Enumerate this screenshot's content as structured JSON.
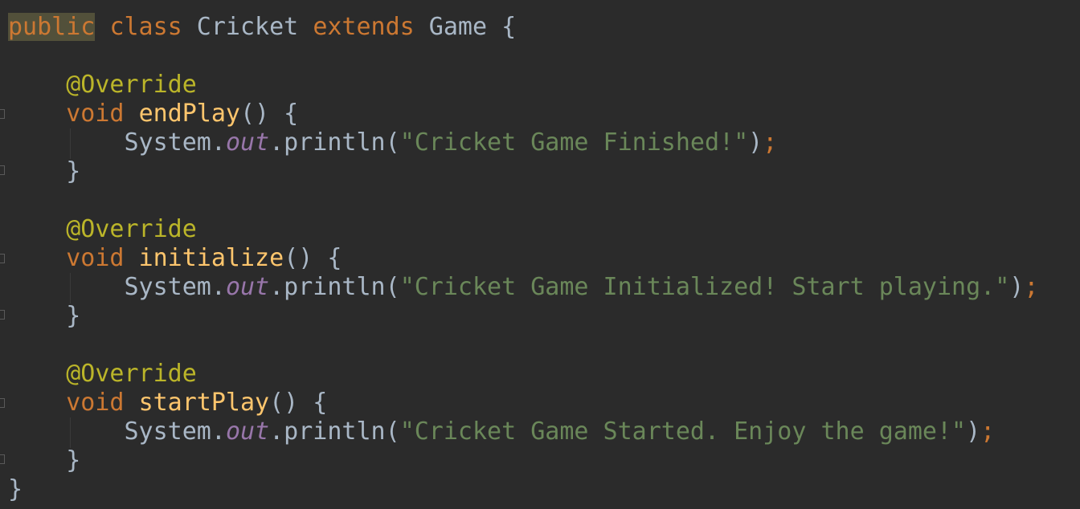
{
  "colors": {
    "background": "#2b2b2b",
    "keyword": "#cc7832",
    "annotation": "#bbb529",
    "method_declaration": "#ffc66d",
    "default_text": "#a9b7c6",
    "static_field": "#9876aa",
    "string": "#6a8759",
    "highlight_background": "#52503a"
  },
  "lines": [
    {
      "tokens": [
        {
          "text": "public",
          "kind": "keyword-hl"
        },
        {
          "text": " ",
          "kind": "plain"
        },
        {
          "text": "class",
          "kind": "keyword"
        },
        {
          "text": " Cricket ",
          "kind": "plain"
        },
        {
          "text": "extends",
          "kind": "keyword"
        },
        {
          "text": " Game {",
          "kind": "plain"
        }
      ]
    },
    {
      "tokens": []
    },
    {
      "tokens": [
        {
          "text": "    ",
          "kind": "plain"
        },
        {
          "text": "@Override",
          "kind": "annotation"
        }
      ]
    },
    {
      "tokens": [
        {
          "text": "    ",
          "kind": "plain"
        },
        {
          "text": "void",
          "kind": "keyword"
        },
        {
          "text": " ",
          "kind": "plain"
        },
        {
          "text": "endPlay",
          "kind": "method"
        },
        {
          "text": "() {",
          "kind": "plain"
        }
      ]
    },
    {
      "tokens": [
        {
          "text": "        System.",
          "kind": "plain"
        },
        {
          "text": "out",
          "kind": "field"
        },
        {
          "text": ".println(",
          "kind": "plain"
        },
        {
          "text": "\"Cricket Game Finished!\"",
          "kind": "string"
        },
        {
          "text": ")",
          "kind": "plain"
        },
        {
          "text": ";",
          "kind": "semicolon"
        }
      ]
    },
    {
      "tokens": [
        {
          "text": "    }",
          "kind": "plain"
        }
      ]
    },
    {
      "tokens": []
    },
    {
      "tokens": [
        {
          "text": "    ",
          "kind": "plain"
        },
        {
          "text": "@Override",
          "kind": "annotation"
        }
      ]
    },
    {
      "tokens": [
        {
          "text": "    ",
          "kind": "plain"
        },
        {
          "text": "void",
          "kind": "keyword"
        },
        {
          "text": " ",
          "kind": "plain"
        },
        {
          "text": "initialize",
          "kind": "method"
        },
        {
          "text": "() {",
          "kind": "plain"
        }
      ]
    },
    {
      "tokens": [
        {
          "text": "        System.",
          "kind": "plain"
        },
        {
          "text": "out",
          "kind": "field"
        },
        {
          "text": ".println(",
          "kind": "plain"
        },
        {
          "text": "\"Cricket Game Initialized! Start playing.\"",
          "kind": "string"
        },
        {
          "text": ")",
          "kind": "plain"
        },
        {
          "text": ";",
          "kind": "semicolon"
        }
      ]
    },
    {
      "tokens": [
        {
          "text": "    }",
          "kind": "plain"
        }
      ]
    },
    {
      "tokens": []
    },
    {
      "tokens": [
        {
          "text": "    ",
          "kind": "plain"
        },
        {
          "text": "@Override",
          "kind": "annotation"
        }
      ]
    },
    {
      "tokens": [
        {
          "text": "    ",
          "kind": "plain"
        },
        {
          "text": "void",
          "kind": "keyword"
        },
        {
          "text": " ",
          "kind": "plain"
        },
        {
          "text": "startPlay",
          "kind": "method"
        },
        {
          "text": "() {",
          "kind": "plain"
        }
      ]
    },
    {
      "tokens": [
        {
          "text": "        System.",
          "kind": "plain"
        },
        {
          "text": "out",
          "kind": "field"
        },
        {
          "text": ".println(",
          "kind": "plain"
        },
        {
          "text": "\"Cricket Game Started. Enjoy the game!\"",
          "kind": "string"
        },
        {
          "text": ")",
          "kind": "plain"
        },
        {
          "text": ";",
          "kind": "semicolon"
        }
      ]
    },
    {
      "tokens": [
        {
          "text": "    }",
          "kind": "plain"
        }
      ]
    },
    {
      "tokens": [
        {
          "text": "}",
          "kind": "plain"
        }
      ]
    }
  ]
}
